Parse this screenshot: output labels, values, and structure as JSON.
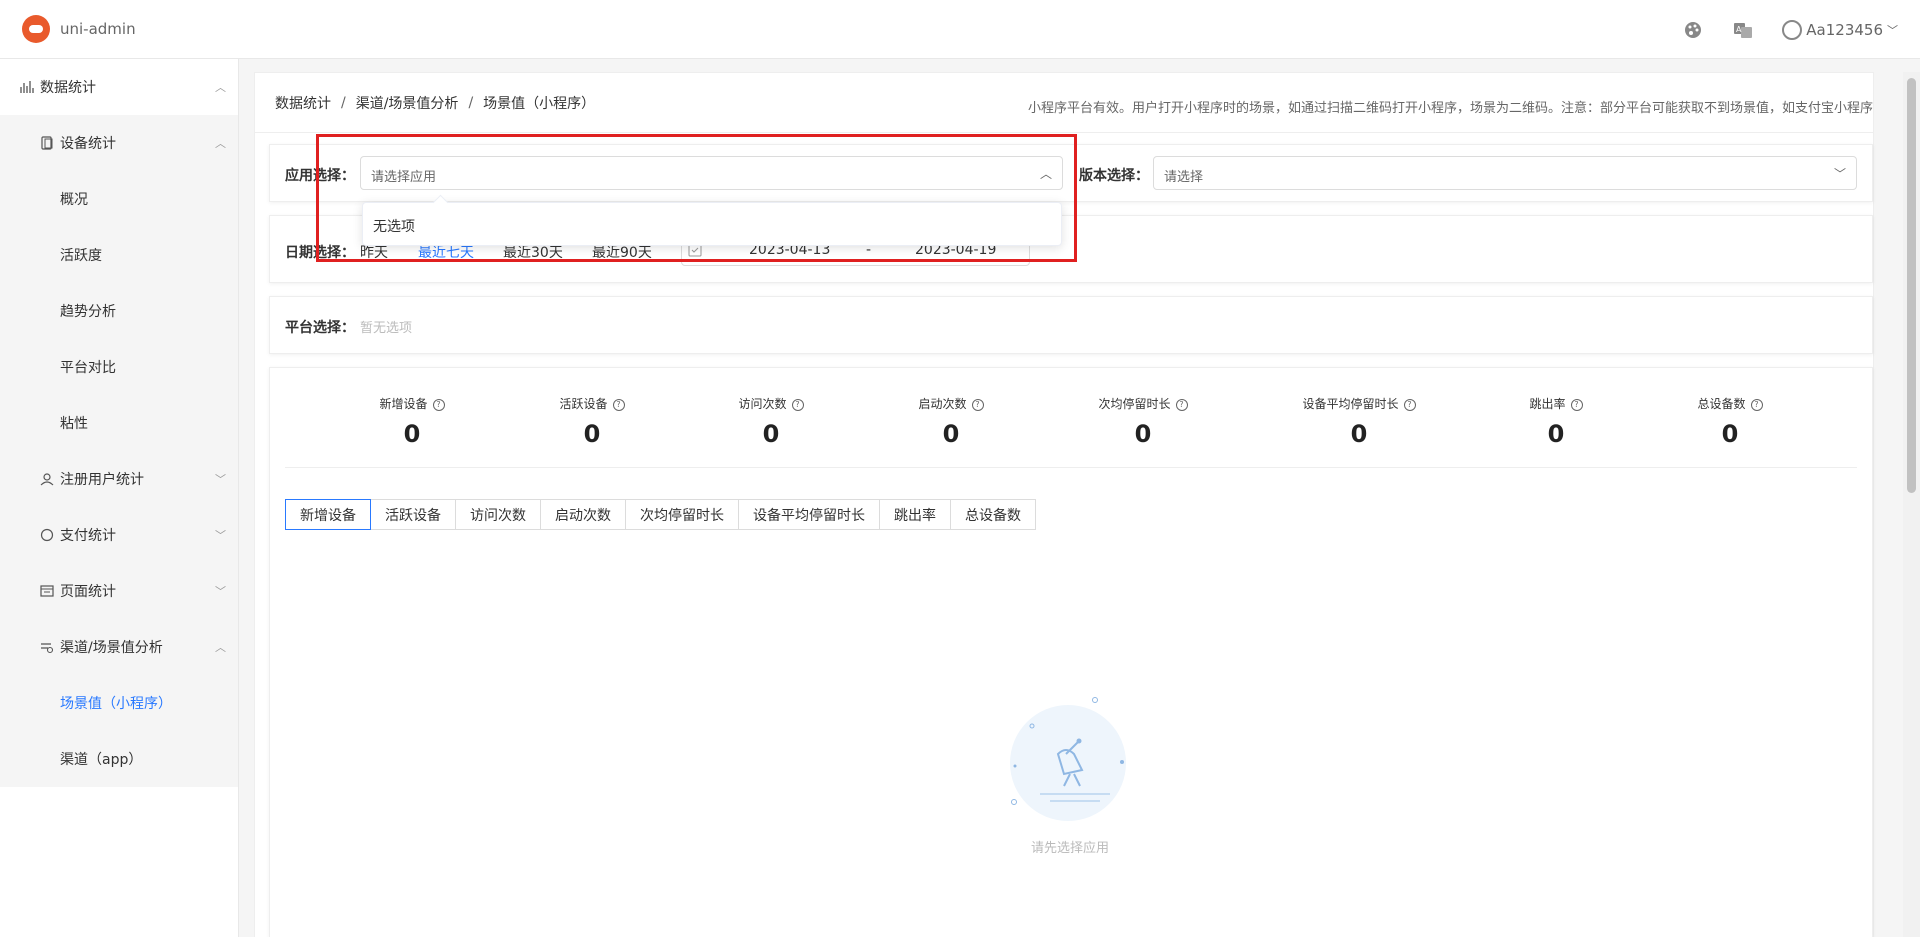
{
  "navbar": {
    "app_title": "uni-admin",
    "username": "Aa123456",
    "icons": [
      "palette-icon",
      "translate-icon",
      "user-avatar-icon"
    ]
  },
  "sidebar": {
    "items": [
      {
        "label": "数据统计",
        "level": 1,
        "icon": "chart-icon",
        "expanded": true
      },
      {
        "label": "设备统计",
        "level": 2,
        "icon": "device-icon",
        "expanded": true
      },
      {
        "label": "概况",
        "level": 3
      },
      {
        "label": "活跃度",
        "level": 3
      },
      {
        "label": "趋势分析",
        "level": 3
      },
      {
        "label": "平台对比",
        "level": 3
      },
      {
        "label": "粘性",
        "level": 3
      },
      {
        "label": "注册用户统计",
        "level": 2,
        "icon": "user-icon",
        "expanded": false
      },
      {
        "label": "支付统计",
        "level": 2,
        "icon": "circle-icon",
        "expanded": false
      },
      {
        "label": "页面统计",
        "level": 2,
        "icon": "page-icon",
        "expanded": false
      },
      {
        "label": "渠道/场景值分析",
        "level": 2,
        "icon": "channel-icon",
        "expanded": true
      },
      {
        "label": "场景值（小程序）",
        "level": 3,
        "active": true
      },
      {
        "label": "渠道（app）",
        "level": 3
      }
    ]
  },
  "breadcrumb": {
    "items": [
      "数据统计",
      "渠道/场景值分析",
      "场景值（小程序）"
    ],
    "separator": "/"
  },
  "description": "小程序平台有效。用户打开小程序时的场景，如通过扫描二维码打开小程序，场景为二维码。注意：部分平台可能获取不到场景值，如支付宝小程序",
  "filters": {
    "app_label": "应用选择：",
    "app_placeholder": "请选择应用",
    "app_dropdown_empty": "无选项",
    "version_label": "版本选择：",
    "version_placeholder": "请选择",
    "date_label": "日期选择：",
    "date_options": [
      "昨天",
      "最近七天",
      "最近30天",
      "最近90天"
    ],
    "date_active": "最近七天",
    "date_start": "2023-04-13",
    "date_sep": "-",
    "date_end": "2023-04-19",
    "platform_label": "平台选择：",
    "platform_placeholder": "暂无选项"
  },
  "stats": [
    {
      "label": "新增设备",
      "value": "0"
    },
    {
      "label": "活跃设备",
      "value": "0"
    },
    {
      "label": "访问次数",
      "value": "0"
    },
    {
      "label": "启动次数",
      "value": "0"
    },
    {
      "label": "次均停留时长",
      "value": "0"
    },
    {
      "label": "设备平均停留时长",
      "value": "0"
    },
    {
      "label": "跳出率",
      "value": "0"
    },
    {
      "label": "总设备数",
      "value": "0"
    }
  ],
  "tabs": [
    "新增设备",
    "活跃设备",
    "访问次数",
    "启动次数",
    "次均停留时长",
    "设备平均停留时长",
    "跳出率",
    "总设备数"
  ],
  "active_tab": "新增设备",
  "empty_state": "请先选择应用",
  "colors": {
    "accent": "#2979ff",
    "highlight": "#e02020",
    "logo": "#e95a2c"
  }
}
